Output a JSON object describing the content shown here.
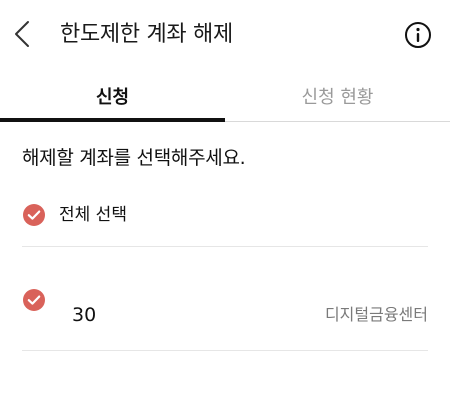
{
  "header": {
    "title": "한도제한 계좌 해제",
    "back_icon": "chevron-left-icon",
    "info_icon": "info-circle-icon"
  },
  "tabs": [
    {
      "label": "신청",
      "active": true
    },
    {
      "label": "신청 현황",
      "active": false
    }
  ],
  "instruction": "해제할 계좌를 선택해주세요.",
  "select_all": {
    "label": "전체 선택",
    "checked": true
  },
  "accounts": [
    {
      "number": "30",
      "bank": "디지털금융센터",
      "checked": true
    }
  ],
  "colors": {
    "check_fill": "#d9625a",
    "active_tab": "#111111",
    "inactive_tab": "#9a9a9a",
    "secondary_text": "#7a7a7a"
  }
}
